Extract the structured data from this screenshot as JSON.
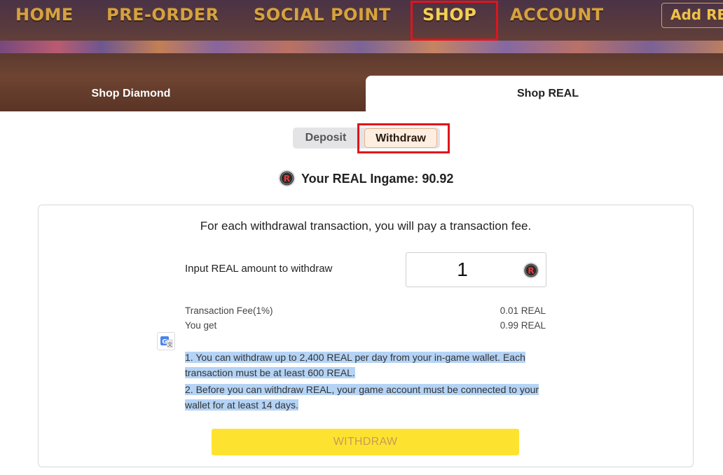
{
  "header": {
    "nav": [
      {
        "label": "HOME",
        "active": false
      },
      {
        "label": "PRE-ORDER",
        "active": false
      },
      {
        "label": "SOCIAL POINT",
        "active": false
      },
      {
        "label": "SHOP",
        "active": true
      },
      {
        "label": "ACCOUNT",
        "active": false
      }
    ],
    "add_button_label": "Add RE"
  },
  "tabs": [
    {
      "label": "Shop Diamond",
      "active": false
    },
    {
      "label": "Shop REAL",
      "active": true
    }
  ],
  "mode_toggle": {
    "deposit_label": "Deposit",
    "withdraw_label": "Withdraw",
    "selected": "Withdraw"
  },
  "balance": {
    "text": "Your REAL Ingame: 90.92",
    "icon": "real-token-icon"
  },
  "withdraw_form": {
    "fee_notice": "For each withdrawal transaction, you will pay a transaction fee.",
    "amount_label": "Input REAL amount to withdraw",
    "amount_value": "1",
    "fee_label": "Transaction Fee(1%)",
    "fee_value": "0.01 REAL",
    "receive_label": "You get",
    "receive_value": "0.99 REAL",
    "rules": [
      "1. You can withdraw up to 2,400 REAL per day from your in-game wallet. Each transaction must be at least 600 REAL.",
      "2. Before you can withdraw REAL, your game account must be connected to your wallet for at least 14 days."
    ],
    "submit_label": "WITHDRAW"
  },
  "colors": {
    "highlight_box": "#e0141c",
    "nav_gold": "#d6a23e",
    "withdraw_button": "#fde330",
    "text_selection": "#b4d3f5"
  }
}
